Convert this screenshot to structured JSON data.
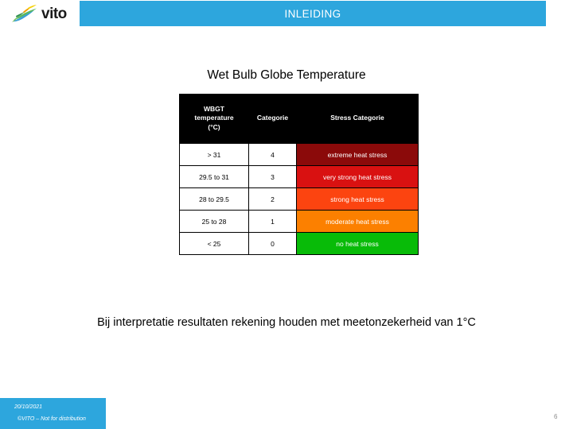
{
  "header": {
    "logo_name": "vito",
    "logo_icon": "vito-bird-logo",
    "title": "INLEIDING",
    "bar_color": "#2da6dd"
  },
  "content": {
    "title": "Wet Bulb Globe Temperature",
    "note": "Bij interpretatie resultaten rekening houden met meetonzekerheid van 1°C"
  },
  "table": {
    "columns": [
      "WBGT temperature (°C)",
      "Categorie",
      "Stress Categorie"
    ],
    "header_col1_line1": "WBGT",
    "header_col1_line2": "temperature",
    "header_col1_line3": "(°C)",
    "header_col2": "Categorie",
    "header_col3": "Stress Categorie",
    "rows": [
      {
        "temperature": "> 31",
        "categorie": "4",
        "stress": "extreme heat stress",
        "color": "#8B0A0A"
      },
      {
        "temperature": "29.5 to 31",
        "categorie": "3",
        "stress": "very strong heat stress",
        "color": "#D91111"
      },
      {
        "temperature": "28 to 29.5",
        "categorie": "2",
        "stress": "strong heat stress",
        "color": "#FC4410"
      },
      {
        "temperature": "25 to 28",
        "categorie": "1",
        "stress": "moderate heat stress",
        "color": "#FC8000"
      },
      {
        "temperature": "< 25",
        "categorie": "0",
        "stress": "no heat stress",
        "color": "#08BB08"
      }
    ]
  },
  "footer": {
    "date": "20/10/2021",
    "copyright": "©VITO – Not for distribution",
    "page_number": "6",
    "box_color": "#2da6dd"
  }
}
